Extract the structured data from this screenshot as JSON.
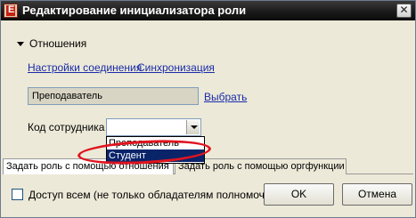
{
  "window": {
    "title": "Редактирование инициализатора роли",
    "close_glyph": "✕"
  },
  "section": {
    "title": "Отношения"
  },
  "links": {
    "connection_settings": "Настройки соединения",
    "sync": "Синхронизация",
    "choose": "Выбрать"
  },
  "teacher_field": {
    "value": "Преподаватель"
  },
  "employee_code": {
    "label": "Код сотрудника",
    "value": "",
    "options": [
      "Преподаватель",
      "Студент"
    ],
    "highlighted": "Студент"
  },
  "tabs": [
    {
      "label": "Задать роль с помощью отношения"
    },
    {
      "label": "Задать роль с помощью оргфункции"
    }
  ],
  "access_all": {
    "label": "Доступ всем (не только обладателям полномочий)",
    "checked": false
  },
  "buttons": {
    "ok": "OK",
    "cancel": "Отмена"
  },
  "colors": {
    "annotation": "#e0141e",
    "link": "#1a2ba8",
    "selection": "#0a246a"
  }
}
